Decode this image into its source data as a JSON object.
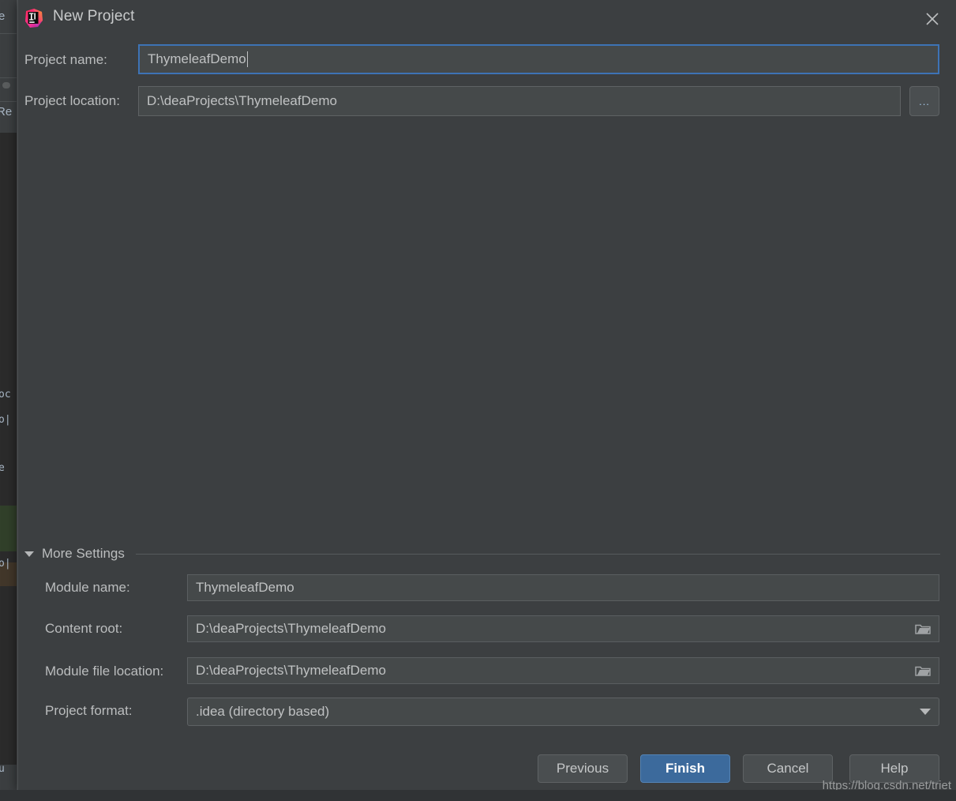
{
  "dialog": {
    "title": "New Project",
    "app_icon": "intellij-idea-logo",
    "close_icon": "close-icon"
  },
  "fields": {
    "project_name": {
      "label": "Project name:",
      "value": "ThymeleafDemo",
      "focused": true
    },
    "project_location": {
      "label": "Project location:",
      "value": "D:\\deaProjects\\ThymeleafDemo",
      "browse_label": "...",
      "browse_icon": "ellipsis-browse-icon"
    }
  },
  "more_settings": {
    "title": "More Settings",
    "expanded": true,
    "collapse_icon": "chevron-down-icon",
    "module_name": {
      "label": "Module name:",
      "value": "ThymeleafDemo"
    },
    "content_root": {
      "label": "Content root:",
      "value": "D:\\deaProjects\\ThymeleafDemo",
      "browse_icon": "folder-icon"
    },
    "module_file_location": {
      "label": "Module file location:",
      "value": "D:\\deaProjects\\ThymeleafDemo",
      "browse_icon": "folder-icon"
    },
    "project_format": {
      "label": "Project format:",
      "value": ".idea (directory based)",
      "dropdown_icon": "chevron-down-icon"
    }
  },
  "footer": {
    "previous": "Previous",
    "finish": "Finish",
    "cancel": "Cancel",
    "help": "Help"
  },
  "watermark": "https://blog.csdn.net/triet",
  "background_window": {
    "fragments": [
      "e",
      "Re",
      "oc",
      "o|",
      "e",
      "o|",
      "u"
    ]
  },
  "colors": {
    "dialog_background": "#3c3f41",
    "field_background": "#45494a",
    "focus_border": "#3d73b5",
    "primary_button": "#3c6a9c",
    "text": "#bbbdbe",
    "editor_background": "#2b2b2b"
  }
}
